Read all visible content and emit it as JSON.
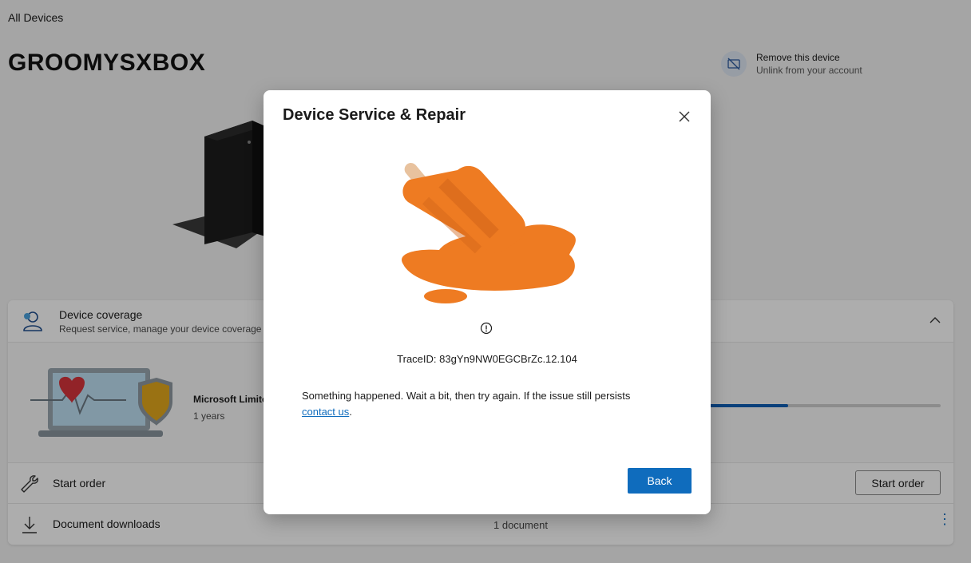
{
  "page": {
    "breadcrumb": "All Devices",
    "device_name": "GROOMYSXBOX",
    "remove": {
      "title": "Remove this device",
      "subtitle": "Unlink from your account"
    }
  },
  "coverage": {
    "title": "Device coverage",
    "subtitle": "Request service, manage your device coverage and",
    "plan_name": "Microsoft Limite",
    "plan_duration": "1 years",
    "progress_fraction": 0.36
  },
  "rows": {
    "start_order_label": "Start order",
    "start_order_button": "Start order",
    "downloads_label": "Document downloads",
    "downloads_count": "1 document"
  },
  "dialog": {
    "title": "Device Service & Repair",
    "trace_id": "TraceID: 83gYn9NW0EGCBrZc.12.104",
    "message": "Something happened. Wait a bit, then try again. If the issue still persists",
    "link": "contact us",
    "after_link": ".",
    "back_label": "Back"
  },
  "colors": {
    "accent": "#0f6cbd",
    "popsicle": "#ee7b22"
  },
  "icons": [
    "close-icon",
    "alert-icon",
    "remove-device-icon",
    "coverage-icon",
    "chevron-up-icon",
    "wrench-icon",
    "download-icon",
    "more-icon"
  ]
}
